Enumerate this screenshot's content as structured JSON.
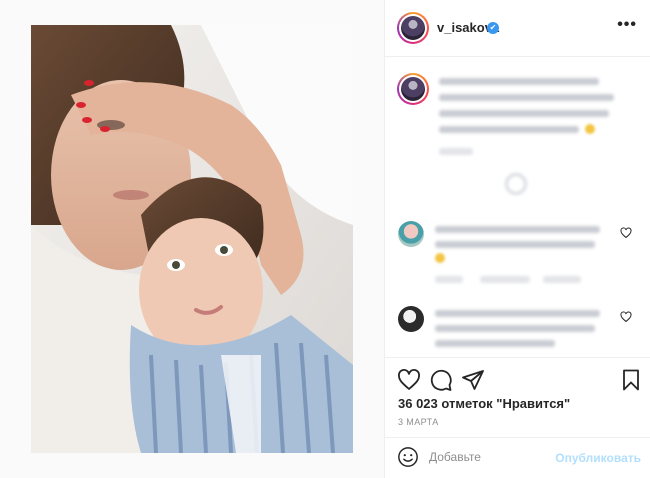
{
  "post": {
    "username": "v_isakova",
    "verified_badge": "✔",
    "more_label": "•••",
    "photo_description_icon": "photo",
    "likes_text": "36 023 отметок \"Нравится\"",
    "date_text": "3 МАРТА"
  },
  "comment_box": {
    "placeholder": "Добавьте",
    "publish_label": "Опубликовать"
  },
  "icons": {
    "like": "heart-icon",
    "comment": "comment-icon",
    "share": "paper-plane-icon",
    "save": "bookmark-icon",
    "emoji": "smiley-icon",
    "more": "ellipsis-icon"
  },
  "colors": {
    "accent_blue": "#3897f0",
    "publish_disabled": "#b2dffc",
    "divider": "#efefef",
    "muted_text": "#8e8e8e"
  }
}
